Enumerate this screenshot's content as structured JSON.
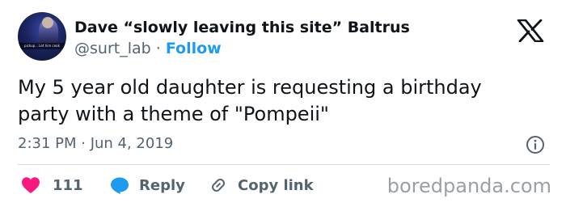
{
  "author": {
    "display_name": "Dave “slowly leaving this site” Baltrus",
    "handle": "@surt_lab",
    "separator": "·",
    "follow_label": "Follow",
    "avatar_caption": "pickup... Let him cook"
  },
  "tweet": {
    "text": "My 5 year old daughter is requesting a birthday\nparty with a theme of \"Pompeii\"",
    "timestamp": "2:31 PM · Jun 4, 2019"
  },
  "actions": {
    "like_count": "111",
    "reply_label": "Reply",
    "copy_link_label": "Copy link"
  },
  "watermark": "boredpanda.com",
  "icons": {
    "logo": "x-logo-icon",
    "info": "info-icon",
    "like": "heart-icon",
    "reply": "speech-bubble-icon",
    "copy_link": "link-icon"
  },
  "colors": {
    "text": "#0f1419",
    "secondary": "#536471",
    "accent": "#1d9bf0",
    "like": "#f91880",
    "divider": "#cfd9de",
    "watermark": "#9aa0a6"
  }
}
